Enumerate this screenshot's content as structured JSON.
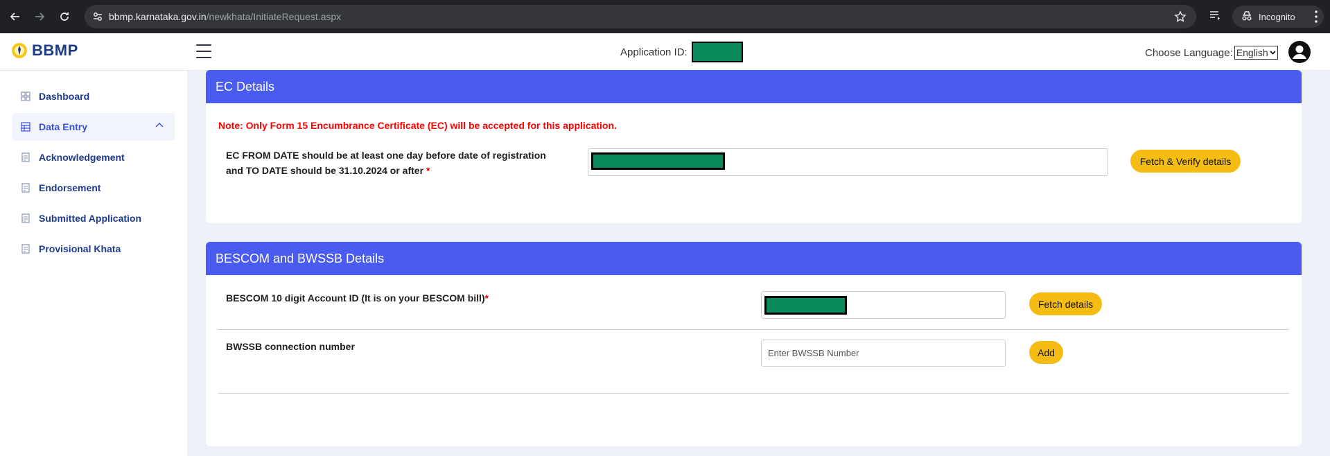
{
  "browser": {
    "url_host": "bbmp.karnataka.gov.in",
    "url_path": "/newkhata/InitiateRequest.aspx",
    "incognito_label": "Incognito",
    "icons": [
      "back-arrow-icon",
      "forward-arrow-icon",
      "reload-icon",
      "site-settings-icon",
      "star-icon",
      "reading-list-icon",
      "incognito-icon",
      "kebab-menu-icon"
    ]
  },
  "header": {
    "logo_text": "BBMP",
    "application_id_label": "Application ID:",
    "choose_language_label": "Choose Language:",
    "language_selected": "English"
  },
  "sidebar": {
    "items": [
      {
        "label": "Dashboard",
        "icon": "grid-icon"
      },
      {
        "label": "Data Entry",
        "icon": "table-icon",
        "active": true
      },
      {
        "label": "Acknowledgement",
        "icon": "document-icon"
      },
      {
        "label": "Endorsement",
        "icon": "document-icon"
      },
      {
        "label": "Submitted Application",
        "icon": "document-icon"
      },
      {
        "label": "Provisional Khata",
        "icon": "document-icon"
      }
    ]
  },
  "ec_section": {
    "title": "EC Details",
    "note": "Note: Only Form 15 Encumbrance Certificate (EC) will be accepted for this application.",
    "field_label_line1": "EC FROM DATE should be at least one day before date of registration",
    "field_label_line2": "and TO DATE should be 31.10.2024 or after",
    "required_mark": "*",
    "button_label": "Fetch & Verify details"
  },
  "bescom_section": {
    "title": "BESCOM and BWSSB Details",
    "bescom_label": "BESCOM 10 digit Account ID (It is on your BESCOM bill)",
    "required_mark": "*",
    "bescom_button": "Fetch details",
    "bwssb_label": "BWSSB connection number",
    "bwssb_placeholder": "Enter BWSSB Number",
    "bwssb_button": "Add"
  },
  "colors": {
    "section_header": "#4a5bef",
    "button": "#f5bd14",
    "note": "#ff0000",
    "redaction": "#0a8a5a"
  }
}
